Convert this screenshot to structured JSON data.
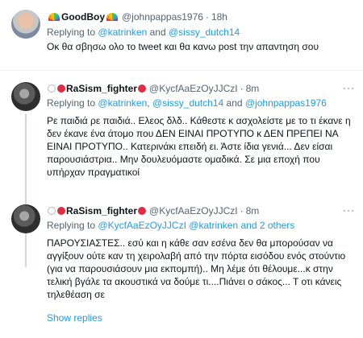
{
  "tweets": [
    {
      "name": "GoodBoy",
      "handle": "@johnpappas1976",
      "dot": "·",
      "time": "18h",
      "reply_prefix": "Replying to",
      "mentions": [
        "@katrinken",
        "@sissy_dutch14"
      ],
      "and": "and",
      "text": "Οκ θα σβησω ολο το tweet και θα κανω post την απαντηση σου"
    },
    {
      "name": "RaSism_fighter",
      "handle": "@KycfAaEzOyJJCzI",
      "dot": "·",
      "time": "8m",
      "reply_prefix": "Replying to",
      "mentions": [
        "@katrinken",
        "@sissy_dutch14",
        "@johnpappas1976"
      ],
      "sep": ",",
      "and": "and",
      "text": "Ρε παιδιά ρε παιδιά.. Ελεος δλδ.. Κάθεστε κ ασχολείστε με το τι έκανε η δεν έκανε ένα άτομο που ΔΕΝ ΕΙΝΑΙ ΠΡΟΤΥΠΟ κ ΔΕΝ ΠΡΕΠΕΙ ΝΑ ΕΙΝΑΙ ΠΡΟΤΥΠΟ.. Κατερινάκι επειδή ει. Άστε ίδια γενιά... Δεν είσαι παρουσιάστρια.. Μην δουλευόμαστε ομαδικά. Σε μια εποχή που υπήρχαν πραγματικοί"
    },
    {
      "name": "RaSism_fighter",
      "handle": "@KycfAaEzOyJJCzI",
      "dot": "·",
      "time": "8m",
      "reply_prefix": "Replying to",
      "mentions": [
        "@KycfAaEzOyJJCzI",
        "@katrinken"
      ],
      "and_others": "and 2 others",
      "text": "ΠΑΡΟΥΣΙΑΣΤΕΣ.. εσύ και η κάθε σαν εσένα δεν θα μπορούσαν να αγγίξουν ούτε καν τη χειρολαβή από την πόρτα εισόδου ενός στούντιο (για να παρουσιάσουν μια εκπομπή).. Μη λέμε ότι θέλουμε...κ στην τελική βγάλε τα ακουστικά να δούμε τι....Πιάνει ο σάκος... Τ οτι κάνεις τηλεθέαση σε"
    }
  ],
  "more_icon": "···",
  "show_replies": "Show replies",
  "colors": {
    "accent": "#1d9bf0",
    "muted": "#536471",
    "divider": "#eff3f4"
  },
  "icons": {
    "rainbow": "rainbow-flag-icon",
    "white_circle": "white-circle-icon",
    "red_circle": "red-circle-icon",
    "more": "more-options-icon"
  }
}
